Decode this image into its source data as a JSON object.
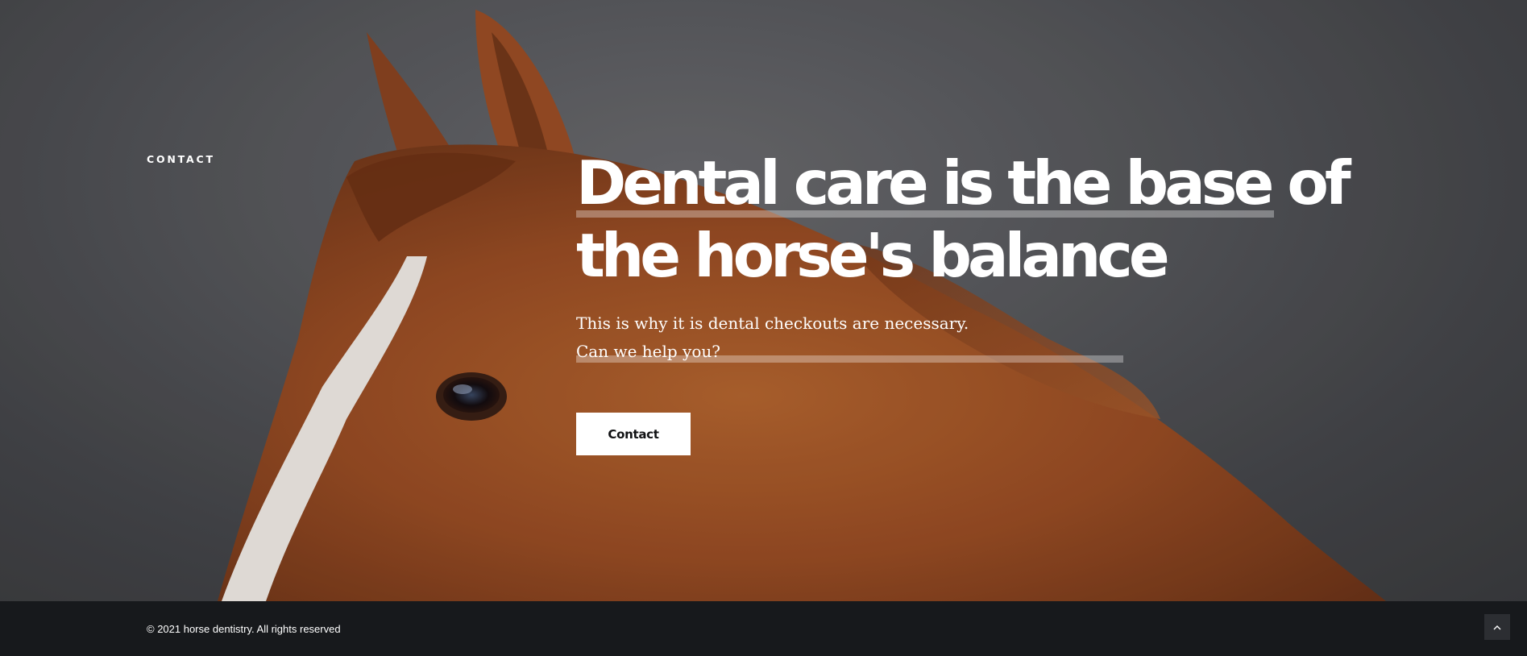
{
  "hero": {
    "side_label": "CONTACT",
    "headline": {
      "line1": "Dental care is the base of",
      "line2": "the horse's balance"
    },
    "subtext": {
      "line1": "This is why it is dental checkouts are necessary.",
      "line2": "Can we help you?"
    },
    "cta_label": "Contact"
  },
  "footer": {
    "copyright": "© 2021 horse dentistry. All rights reserved",
    "back_to_top_icon": "chevron-up-icon"
  },
  "colors": {
    "background": "#4f5054",
    "horse_coat": "#a4532a",
    "footer_bg": "#17191c",
    "button_bg": "#ffffff",
    "text": "#ffffff"
  }
}
